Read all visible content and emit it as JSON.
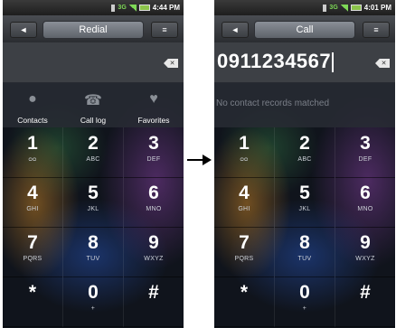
{
  "left": {
    "status": {
      "network": "3G",
      "time": "4:44 PM"
    },
    "title": "Redial",
    "back_glyph": "◄",
    "menu_glyph": "≡",
    "number": "",
    "backspace_glyph": "✕",
    "shortcuts": [
      {
        "label": "Contacts",
        "icon": "contacts-icon",
        "glyph": "●"
      },
      {
        "label": "Call log",
        "icon": "call-log-icon",
        "glyph": "☎"
      },
      {
        "label": "Favorites",
        "icon": "favorites-icon",
        "glyph": "♥"
      }
    ]
  },
  "right": {
    "status": {
      "network": "3G",
      "time": "4:01 PM"
    },
    "title": "Call",
    "back_glyph": "◄",
    "menu_glyph": "≡",
    "number": "0911234567",
    "backspace_glyph": "✕",
    "no_match_text": "No contact records matched"
  },
  "keys": [
    {
      "digit": "1",
      "sub": "ᴑᴑ"
    },
    {
      "digit": "2",
      "sub": "ABC"
    },
    {
      "digit": "3",
      "sub": "DEF"
    },
    {
      "digit": "4",
      "sub": "GHI"
    },
    {
      "digit": "5",
      "sub": "JKL"
    },
    {
      "digit": "6",
      "sub": "MNO"
    },
    {
      "digit": "7",
      "sub": "PQRS"
    },
    {
      "digit": "8",
      "sub": "TUV"
    },
    {
      "digit": "9",
      "sub": "WXYZ"
    },
    {
      "digit": "*",
      "sub": ""
    },
    {
      "digit": "0",
      "sub": "+"
    },
    {
      "digit": "#",
      "sub": ""
    }
  ],
  "arrow_color": "#000000"
}
